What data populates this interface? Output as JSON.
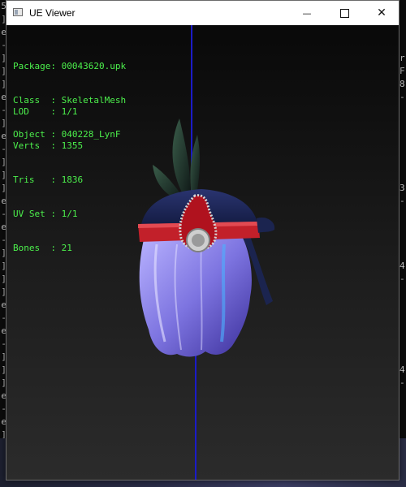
{
  "window": {
    "title": "UE Viewer",
    "minimize_glyph": "—",
    "close_glyph": "✕"
  },
  "info": {
    "package": "Package: 00043620.upk",
    "class": "Class  : SkeletalMesh",
    "object": "Object : 040228_LynF",
    "lod": "LOD    : 1/1",
    "verts": "Verts  : 1355",
    "tris": "Tris   : 1836",
    "uv_set": "UV Set : 1/1",
    "bones": "Bones  : 21"
  },
  "background_console": {
    "left_chars": [
      "5",
      "]",
      "e",
      "-",
      "]",
      "]",
      "]",
      "e",
      "-",
      "]",
      "e",
      "-",
      "]",
      "]",
      "]",
      "e",
      "-",
      "e",
      "-",
      "]",
      "]",
      "]",
      "]",
      "e",
      "-",
      "e",
      "-",
      "]",
      "]",
      "]",
      "e",
      "-",
      "e",
      "]"
    ],
    "right_chars": [
      "",
      "",
      "",
      "",
      "r",
      "F",
      "8",
      "-",
      "",
      "",
      "",
      "",
      "",
      "",
      "3",
      "-",
      "",
      "",
      "",
      "",
      "4",
      "-",
      "",
      "",
      "",
      "",
      "",
      "",
      "4",
      "-",
      "",
      ""
    ]
  },
  "colors": {
    "info_text": "#4cf04c",
    "axis": "#1b1bc8",
    "hat_band": "#c2202a",
    "hair": "#8a82e8"
  },
  "icons": {
    "app": "window-icon",
    "minimize": "minimize-icon",
    "maximize": "maximize-icon",
    "close": "close-icon"
  }
}
